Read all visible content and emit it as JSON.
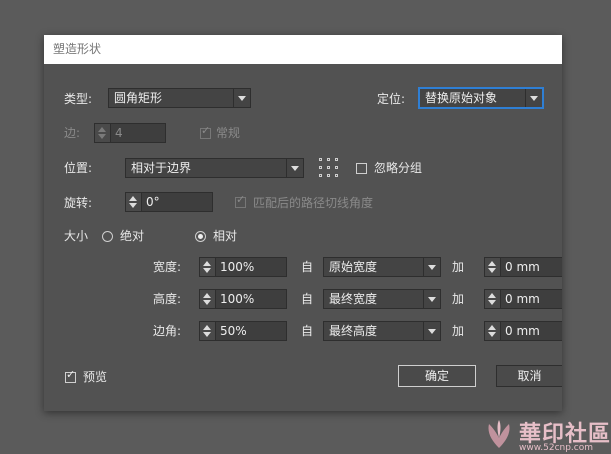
{
  "window": {
    "title": "塑造形状"
  },
  "type": {
    "label": "类型:",
    "value": "圆角矩形"
  },
  "position_mode": {
    "label": "定位:",
    "value": "替换原始对象"
  },
  "sides": {
    "label": "边:",
    "value": "4",
    "regular_label": "常规",
    "regular_checked": true
  },
  "location": {
    "label": "位置:",
    "value": "相对于边界",
    "ignore_group_label": "忽略分组",
    "ignore_group_checked": false
  },
  "rotation": {
    "label": "旋转:",
    "value": "0°",
    "match_path_label": "匹配后的路径切线角度",
    "match_path_checked": true
  },
  "size": {
    "label": "大小",
    "absolute_label": "绝对",
    "relative_label": "相对",
    "selected": "relative"
  },
  "rows": [
    {
      "label": "宽度:",
      "value": "100%",
      "from": "自",
      "ref": "原始宽度",
      "plus": "加",
      "add": "0 mm"
    },
    {
      "label": "高度:",
      "value": "100%",
      "from": "自",
      "ref": "最终宽度",
      "plus": "加",
      "add": "0 mm"
    },
    {
      "label": "边角:",
      "value": "50%",
      "from": "自",
      "ref": "最终高度",
      "plus": "加",
      "add": "0 mm"
    }
  ],
  "preview": {
    "label": "预览",
    "checked": true
  },
  "buttons": {
    "ok": "确定",
    "cancel": "取消"
  },
  "watermark": {
    "text": "華印社區",
    "url": "www.52cnp.com"
  },
  "colors": {
    "dialog_bg": "#525252",
    "desktop_bg": "#5b5b5b",
    "focus": "#2f7fd4"
  }
}
